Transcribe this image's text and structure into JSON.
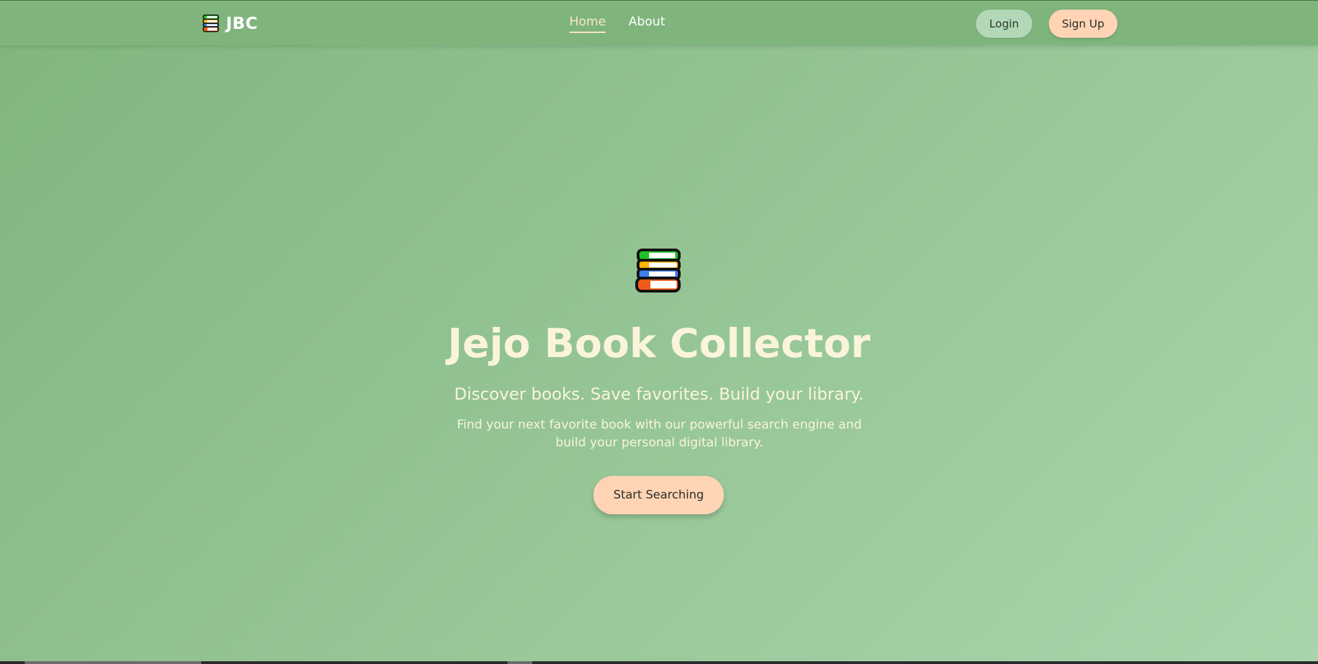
{
  "nav": {
    "brand_name": "JBC",
    "brand_icon": "book-stack-icon",
    "links": [
      {
        "label": "Home",
        "active": true
      },
      {
        "label": "About",
        "active": false
      }
    ],
    "login_label": "Login",
    "signup_label": "Sign Up"
  },
  "hero": {
    "icon": "book-stack-icon",
    "title": "Jejo Book Collector",
    "subtitle": "Discover books. Save favorites. Build your library.",
    "description": "Find your next favorite book with our powerful search engine and build your personal digital library.",
    "cta_label": "Start Searching"
  },
  "colors": {
    "nav_bg": "#7fb57d",
    "hero_gradient_start": "#7fb57d",
    "hero_gradient_end": "#a9d5ac",
    "title_text": "#faf4dd",
    "active_link": "#fde3c6",
    "primary_button": "#ffd4b4",
    "secondary_button": "#b3d8b7"
  }
}
